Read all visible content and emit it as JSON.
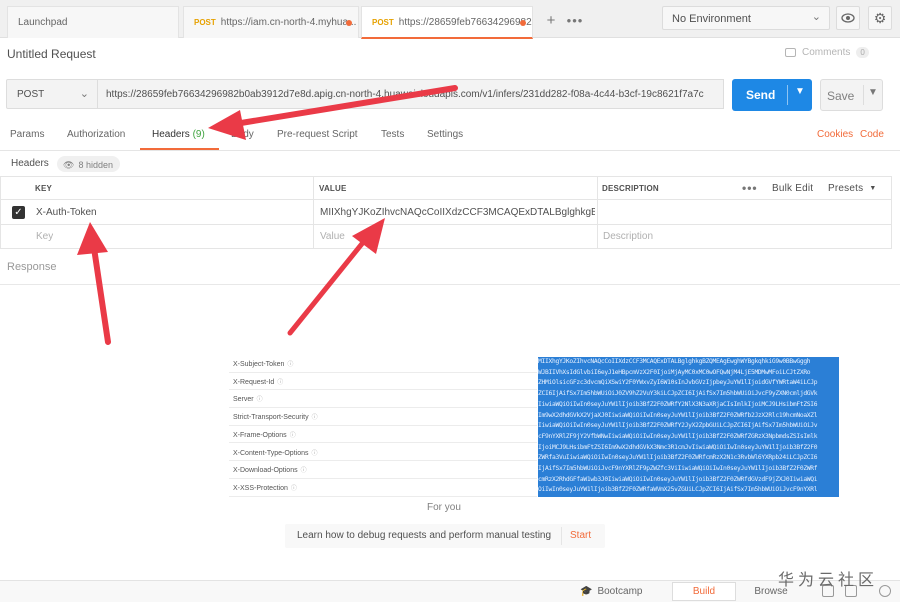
{
  "tabs": [
    {
      "label": "Launchpad",
      "method": ""
    },
    {
      "label": "https://iam.cn-north-4.myhua...",
      "method": "POST"
    },
    {
      "label": "https://28659feb76634296982...",
      "method": "POST"
    }
  ],
  "environment": "No Environment",
  "request": {
    "title": "Untitled Request",
    "comments_label": "Comments",
    "comments_count": "0",
    "method": "POST",
    "url": "https://28659feb76634296982b0ab3912d7e8d.apig.cn-north-4.huaweicloudapis.com/v1/infers/231dd282-f08a-4c44-b3cf-19c8621f7a7c",
    "send_label": "Send",
    "save_label": "Save"
  },
  "req_tabs": {
    "params": "Params",
    "authorization": "Authorization",
    "headers": "Headers",
    "headers_count": "(9)",
    "body": "Body",
    "prerequest": "Pre-request Script",
    "tests": "Tests",
    "settings": "Settings",
    "cookies": "Cookies",
    "code": "Code"
  },
  "headers_section": {
    "label": "Headers",
    "hidden": "8 hidden",
    "columns": {
      "key": "KEY",
      "value": "VALUE",
      "description": "DESCRIPTION"
    },
    "bulk_edit": "Bulk Edit",
    "presets": "Presets",
    "rows": [
      {
        "key": "X-Auth-Token",
        "value": "MIIXhgYJKoZIhvcNAQcCoIIXdzCCF3MCAQExDTALBglghkgBZQ",
        "description": ""
      }
    ],
    "placeholders": {
      "key": "Key",
      "value": "Value",
      "description": "Description"
    }
  },
  "response_label": "Response",
  "embedded_headers": [
    "X-Subject-Token",
    "X-Request-Id",
    "Server",
    "Strict-Transport-Security",
    "X-Frame-Options",
    "X-Content-Type-Options",
    "X-Download-Options",
    "X-XSS-Protection"
  ],
  "token_lines": [
    "MIIXhgYJKoZIhvcNAQcCoIIXdzCCF3MCAQExDTALBglghkgBZQMEAgEwghWYBgkqhkiG9w0BBwGggh",
    "WJBIIVhXsIdGlvbiI6eyJ1eHBpcmVzX2F0IjoiMjAyMC0xMC0wOFQwNjM4LjE5MDMwMFoiLCJtZXRo",
    "ZHMiOlsicGFzc3dvcmQiXSwiY2F0YWxvZyI6W10sInJvbGVzIjpbeyJuYW1lIjoidGVfYWRtaW4iLCJp",
    "ZCI6IjAifSx7Im5hbWUiOiJ0ZV9hZ2VuY3kiLCJpZCI6IjAifSx7Im5hbWUiOiJvcF9yZXN0cmljdGVk",
    "IiwiaWQiOiIwIn0seyJuYW1lIjoib3BfZ2F0ZWRfY2NlX3N3aXRjaCIsImlkIjoiMCJ9LHsibmFtZSI6",
    "Im9wX2dhdGVkX2VjaXJ0IiwiaWQiOiIwIn0seyJuYW1lIjoib3BfZ2F0ZWRfb2JzX2Rlc19hcmNoaXZl",
    "IiwiaWQiOiIwIn0seyJuYW1lIjoib3BfZ2F0ZWRfY2JyX2ZpbGUiLCJpZCI6IjAifSx7Im5hbWUiOiJv",
    "cF9nYXRlZF9jY2VfbWNwIiwiaWQiOiIwIn0seyJuYW1lIjoib3BfZ2F0ZWRfZGRzX3NpbmdsZSIsImlk",
    "IjoiMCJ9LHsibmFtZSI6Im9wX2dhdGVkX3Nmc3R1cmJvIiwiaWQiOiIwIn0seyJuYW1lIjoib3BfZ2F0",
    "ZWRfa3VuIiwiaWQiOiIwIn0seyJuYW1lIjoib3BfZ2F0ZWRfcmRzX2N1c3RvbWl6YXRpb24iLCJpZCI6",
    "IjAifSx7Im5hbWUiOiJvcF9nYXRlZF9pZWZfc3ViIiwiaWQiOiIwIn0seyJuYW1lIjoib3BfZ2F0ZWRf",
    "cmRzX2RhdGFfaW1wb3J0IiwiaWQiOiIwIn0seyJuYW1lIjoib3BfZ2F0ZWRfdGVzdF9jZXJ0IiwiaWQi",
    "OiIwIn0seyJuYW1lIjoib3BfZ2F0ZWRfaWVmX25vZGUiLCJpZCI6IjAifSx7Im5hbWUiOiJvcF9nYXRl"
  ],
  "for_you": "For you",
  "banner_text": "Learn how to debug requests and perform manual testing",
  "banner_start": "Start",
  "status": {
    "bootcamp": "Bootcamp",
    "build": "Build",
    "browse": "Browse"
  },
  "watermark": "华为云社区",
  "colors": {
    "accent": "#f26b3a",
    "send": "#1e88e5",
    "arrow": "#ea3a47",
    "selection": "#2b7fd6"
  }
}
